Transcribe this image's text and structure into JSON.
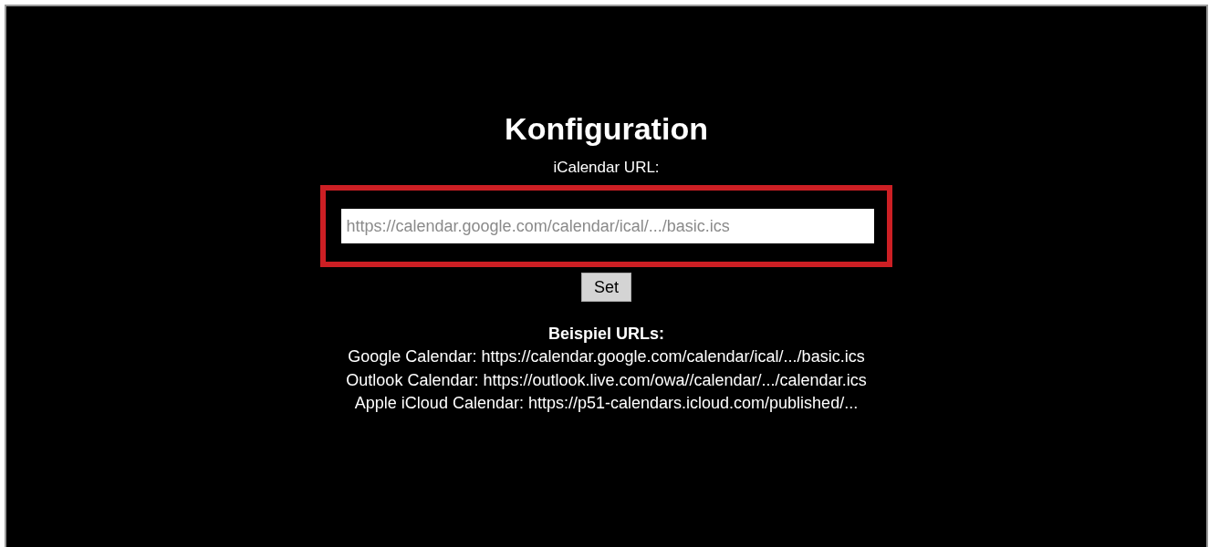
{
  "title": "Konfiguration",
  "field": {
    "label": "iCalendar URL:",
    "placeholder": "https://calendar.google.com/calendar/ical/.../basic.ics",
    "highlighted": true
  },
  "button": "Set",
  "examples": {
    "heading": "Beispiel URLs:",
    "lines": [
      "Google Calendar: https://calendar.google.com/calendar/ical/.../basic.ics",
      "Outlook Calendar: https://outlook.live.com/owa//calendar/.../calendar.ics",
      "Apple iCloud Calendar: https://p51-calendars.icloud.com/published/..."
    ]
  }
}
